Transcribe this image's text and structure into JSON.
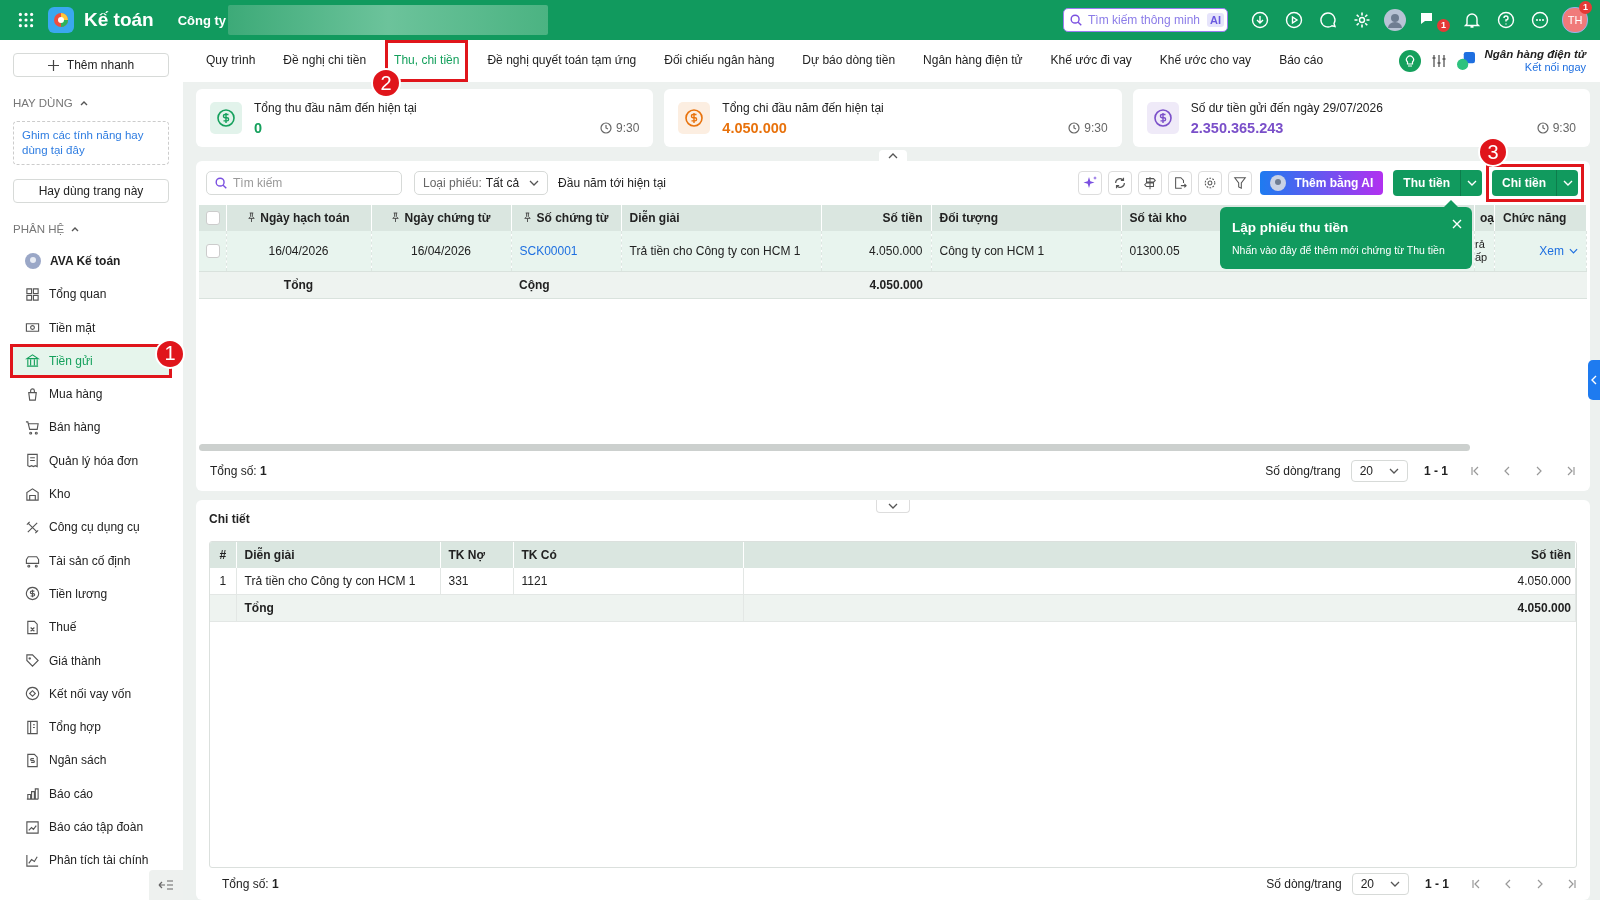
{
  "top_bar": {
    "app_title": "Kế toán",
    "company_label": "Công ty",
    "search_placeholder": "Tìm kiếm thông minh",
    "ai_badge": "AI",
    "chat_badge": "1",
    "avatar_initials": "TH",
    "avatar_badge": "1"
  },
  "sidebar": {
    "quick_add": "Thêm nhanh",
    "favorites": {
      "title": "HAY DÙNG",
      "expanded": true,
      "hint": "Ghim các tính năng hay dùng tại đây",
      "button": "Hay dùng trang này"
    },
    "modules": {
      "title": "PHÂN HỆ",
      "expanded": true,
      "items": [
        {
          "label": "AVA Kế toán",
          "selected": false
        },
        {
          "label": "Tổng quan",
          "selected": false
        },
        {
          "label": "Tiền mặt",
          "selected": false
        },
        {
          "label": "Tiền gửi",
          "selected": true,
          "callout": "1"
        },
        {
          "label": "Mua hàng",
          "selected": false
        },
        {
          "label": "Bán hàng",
          "selected": false
        },
        {
          "label": "Quản lý hóa đơn",
          "selected": false
        },
        {
          "label": "Kho",
          "selected": false
        },
        {
          "label": "Công cụ dụng cụ",
          "selected": false
        },
        {
          "label": "Tài sản cố định",
          "selected": false
        },
        {
          "label": "Tiền lương",
          "selected": false
        },
        {
          "label": "Thuế",
          "selected": false
        },
        {
          "label": "Giá thành",
          "selected": false
        },
        {
          "label": "Kết nối vay vốn",
          "selected": false
        },
        {
          "label": "Tổng hợp",
          "selected": false
        },
        {
          "label": "Ngân sách",
          "selected": false
        },
        {
          "label": "Báo cáo",
          "selected": false
        },
        {
          "label": "Báo cáo tập đoàn",
          "selected": false
        },
        {
          "label": "Phân tích tài chính",
          "selected": false
        }
      ]
    }
  },
  "tabs": [
    {
      "label": "Quy trình",
      "selected": false
    },
    {
      "label": "Đề nghị chi tiền",
      "selected": false
    },
    {
      "label": "Thu, chi tiền",
      "selected": true,
      "callout": "2"
    },
    {
      "label": "Đề nghị quyết toán tạm ứng",
      "selected": false
    },
    {
      "label": "Đối chiếu ngân hàng",
      "selected": false
    },
    {
      "label": "Dự báo dòng tiền",
      "selected": false
    },
    {
      "label": "Ngân hàng điện tử",
      "selected": false
    },
    {
      "label": "Khế ước đi vay",
      "selected": false
    },
    {
      "label": "Khế ước cho vay",
      "selected": false
    },
    {
      "label": "Báo cáo",
      "selected": false
    }
  ],
  "bank_widget": {
    "title": "Ngân hàng điện tử",
    "link": "Kết nối ngay"
  },
  "summary_expanded": true,
  "summary_cards": [
    {
      "title": "Tổng thu đầu năm đến hiện tại",
      "value": "0",
      "time": "9:30",
      "color": "#14a05c"
    },
    {
      "title": "Tổng chi đầu năm đến hiện tại",
      "value": "4.050.000",
      "time": "9:30",
      "color": "#e8720c"
    },
    {
      "title": "Số dư tiền gửi đến ngày 29/07/2026",
      "value": "2.350.365.243",
      "time": "9:30",
      "color": "#7a4fc9"
    }
  ],
  "toolbar": {
    "search_placeholder": "Tìm kiếm",
    "filter_label": "Loại phiếu:",
    "filter_value": "Tất cả",
    "period": "Đầu năm tới hiện tại",
    "ai_button": "Thêm bằng AI",
    "receive_button": "Thu tiền",
    "pay_button": {
      "label": "Chi tiền",
      "callout": "3"
    }
  },
  "table": {
    "all_checked": false,
    "columns": [
      "Ngày hạch toán",
      "Ngày chứng từ",
      "Số chứng từ",
      "Diễn giải",
      "Số tiền",
      "Đối tượng",
      "Số tài kho",
      "oạ",
      "Chức năng"
    ],
    "rows": [
      {
        "checked": false,
        "selected": true,
        "cells": [
          "16/04/2026",
          "16/04/2026",
          "SCK00001",
          "Trả tiền cho Công ty con HCM 1",
          "4.050.000",
          "Công ty con HCM 1",
          "01300.05",
          "rả ấp",
          "Xem"
        ]
      }
    ],
    "totals": {
      "label": "Tổng",
      "label_2": "Cộng",
      "amount": "4.050.000"
    },
    "footer": {
      "total_label": "Tổng số:",
      "total_count": "1",
      "page_size_label": "Số dòng/trang",
      "page_size": "20",
      "range": "1 - 1"
    }
  },
  "tooltip": {
    "title": "Lập phiếu thu tiền",
    "text": "Nhấn vào đây để thêm mới chứng từ Thu tiền"
  },
  "detail": {
    "expanded": true,
    "title": "Chi tiết",
    "columns": [
      "#",
      "Diễn giải",
      "TK Nợ",
      "TK Có",
      "Số tiền"
    ],
    "rows": [
      [
        "1",
        "Trả tiền cho Công ty con HCM 1",
        "331",
        "1121",
        "4.050.000"
      ]
    ],
    "totals": {
      "label": "Tổng",
      "amount": "4.050.000"
    },
    "footer": {
      "total_label": "Tổng số:",
      "total_count": "1",
      "page_size_label": "Số dòng/trang",
      "page_size": "20",
      "range": "1 - 1"
    }
  }
}
